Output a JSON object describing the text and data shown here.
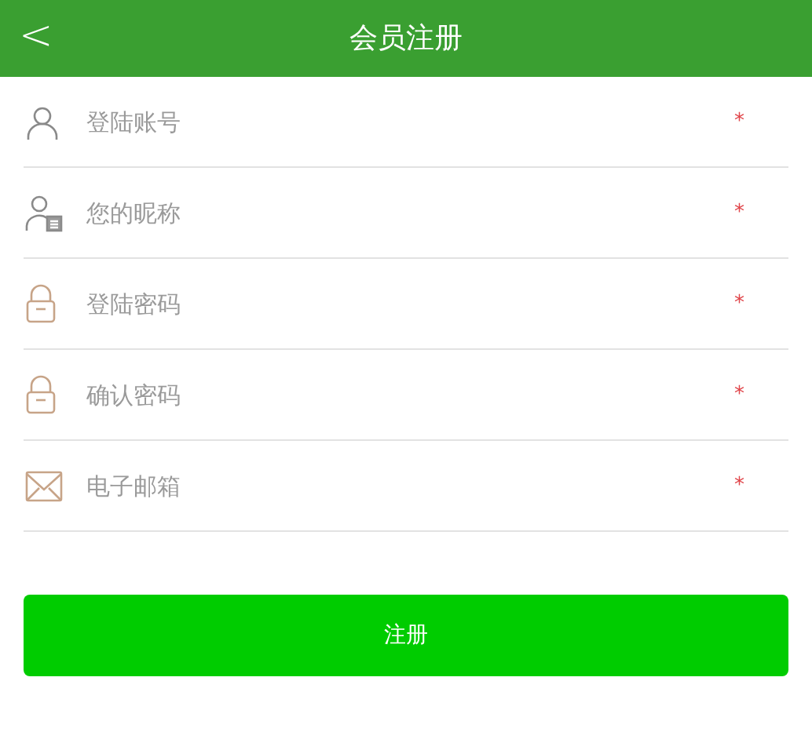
{
  "header": {
    "back": "<",
    "title": "会员注册"
  },
  "fields": [
    {
      "kind": "account",
      "placeholder": "登陆账号",
      "required_mark": "*"
    },
    {
      "kind": "nickname",
      "placeholder": "您的昵称",
      "required_mark": "*"
    },
    {
      "kind": "password",
      "placeholder": "登陆密码",
      "required_mark": "*"
    },
    {
      "kind": "password",
      "placeholder": "确认密码",
      "required_mark": "*"
    },
    {
      "kind": "email",
      "placeholder": "电子邮箱",
      "required_mark": "*"
    }
  ],
  "submit": "注册"
}
